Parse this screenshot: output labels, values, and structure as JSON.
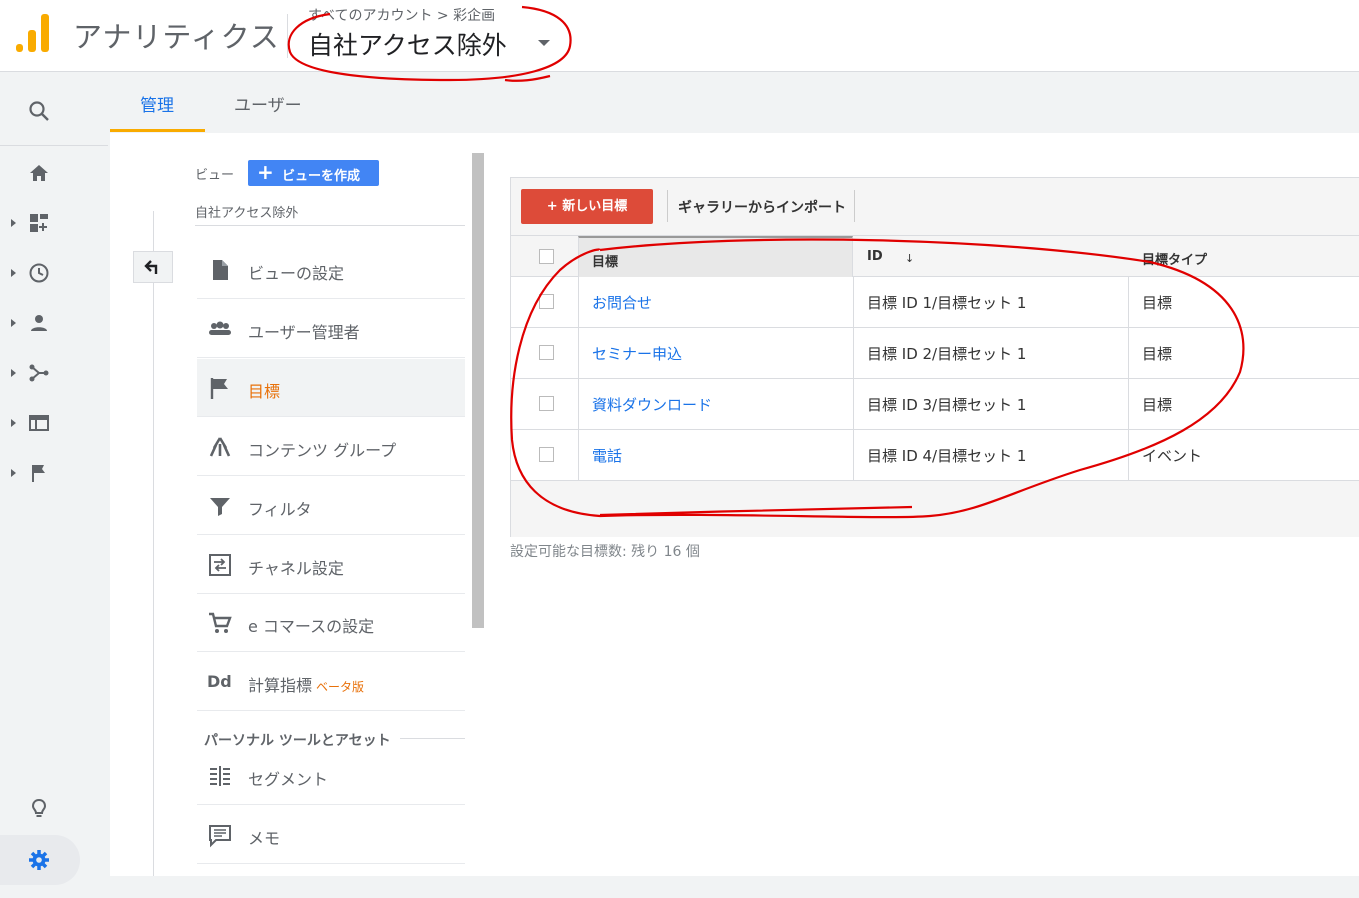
{
  "header": {
    "app_title": "アナリティクス",
    "breadcrumb": "すべてのアカウント > 彩企画",
    "view_selector": "自社アクセス除外"
  },
  "rail": {
    "icons": [
      "search-icon",
      "home-icon",
      "dashboard-icon",
      "clock-icon",
      "person-icon",
      "conversion-icon",
      "behavior-icon",
      "flag-icon",
      "lightbulb-icon",
      "gear-icon"
    ]
  },
  "tabs": [
    {
      "label": "管理",
      "active": true
    },
    {
      "label": "ユーザー",
      "active": false
    }
  ],
  "view_panel": {
    "label": "ビュー",
    "create_button": "ビューを作成",
    "current_view": "自社アクセス除外",
    "items": [
      {
        "label": "ビューの設定",
        "icon": "document-icon"
      },
      {
        "label": "ユーザー管理者",
        "icon": "people-icon"
      },
      {
        "label": "目標",
        "icon": "flag-icon",
        "active": true
      },
      {
        "label": "コンテンツ グループ",
        "icon": "content-group-icon"
      },
      {
        "label": "フィルタ",
        "icon": "filter-icon"
      },
      {
        "label": "チャネル設定",
        "icon": "channel-icon"
      },
      {
        "label": "e コマースの設定",
        "icon": "cart-icon"
      },
      {
        "label": "計算指標",
        "icon": "dd-icon",
        "badge": "ベータ版"
      }
    ],
    "section_title": "パーソナル ツールとアセット",
    "section_items": [
      {
        "label": "セグメント",
        "icon": "segment-icon"
      },
      {
        "label": "メモ",
        "icon": "memo-icon"
      }
    ]
  },
  "goals": {
    "new_goal_button": "+ 新しい目標",
    "import_button": "ギャラリーからインポート",
    "columns": [
      "目標",
      "ID",
      "目標タイプ"
    ],
    "rows": [
      {
        "goal": "お問合せ",
        "id": "目標 ID 1/目標セット 1",
        "type": "目標"
      },
      {
        "goal": "セミナー申込",
        "id": "目標 ID 2/目標セット 1",
        "type": "目標"
      },
      {
        "goal": "資料ダウンロード",
        "id": "目標 ID 3/目標セット 1",
        "type": "目標"
      },
      {
        "goal": "電話",
        "id": "目標 ID 4/目標セット 1",
        "type": "イベント"
      }
    ],
    "remaining_text": "設定可能な目標数: 残り 16 個"
  },
  "colors": {
    "accent": "#f9ab00",
    "active_nav": "#e8710a",
    "primary_button": "#4285f4",
    "new_goal_button": "#dd4b39",
    "link": "#1a73e8",
    "annotation": "#e00000"
  }
}
